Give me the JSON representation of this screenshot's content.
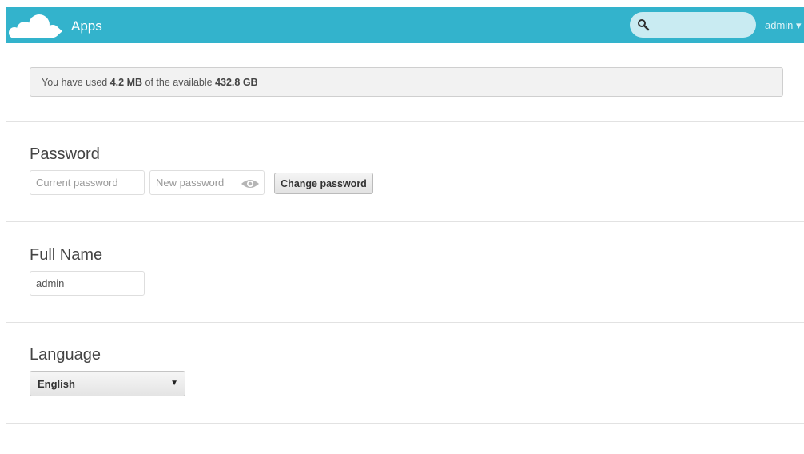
{
  "header": {
    "app_title": "Apps",
    "search": {
      "value": "",
      "placeholder": ""
    },
    "user_menu": "admin ▾",
    "brand_color": "#33b3cc",
    "icons": [
      "cloud-logo-icon",
      "search-icon"
    ]
  },
  "quota": {
    "prefix": "You have used ",
    "used": "4.2 MB",
    "middle": " of the available ",
    "available": "432.8 GB"
  },
  "password_section": {
    "title": "Password",
    "current_placeholder": "Current password",
    "new_placeholder": "New password",
    "show_icon": "eye-icon",
    "button_label": "Change password"
  },
  "fullname_section": {
    "title": "Full Name",
    "value": "admin"
  },
  "language_section": {
    "title": "Language",
    "selected": "English",
    "arrow": "▼"
  }
}
